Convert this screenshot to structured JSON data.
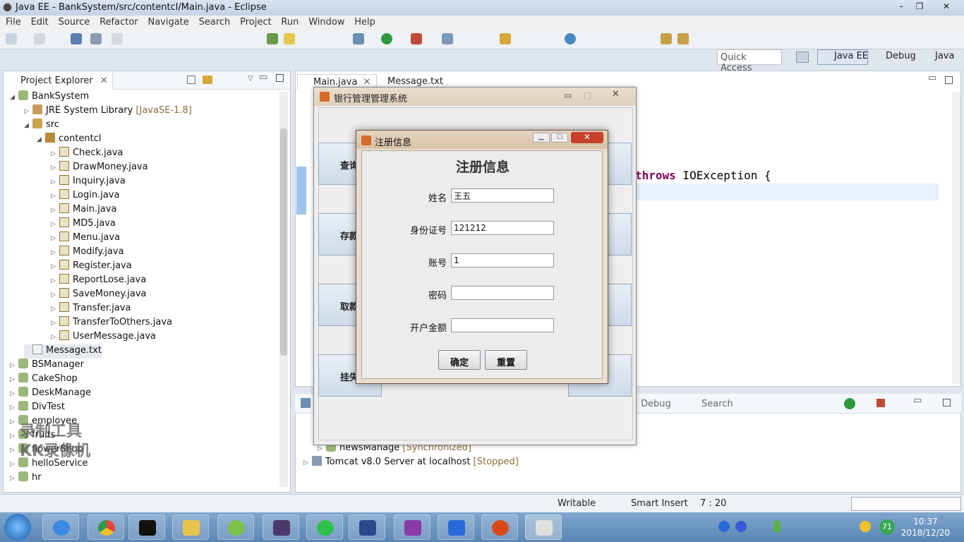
{
  "window": {
    "title": "Java EE - BankSystem/src/contentcl/Main.java - Eclipse"
  },
  "menu": [
    "File",
    "Edit",
    "Source",
    "Refactor",
    "Navigate",
    "Search",
    "Project",
    "Run",
    "Window",
    "Help"
  ],
  "quick_access": "Quick Access",
  "perspectives": [
    "Java EE",
    "Debug",
    "Java"
  ],
  "project_explorer": {
    "title": "Project Explorer",
    "rows": [
      {
        "label": "BankSystem"
      },
      {
        "label": "JRE System Library",
        "suffix": "[JavaSE-1.8]"
      },
      {
        "label": "src"
      },
      {
        "label": "contentcl"
      },
      {
        "label": "Check.java"
      },
      {
        "label": "DrawMoney.java"
      },
      {
        "label": "Inquiry.java"
      },
      {
        "label": "Login.java"
      },
      {
        "label": "Main.java"
      },
      {
        "label": "MD5.java"
      },
      {
        "label": "Menu.java"
      },
      {
        "label": "Modify.java"
      },
      {
        "label": "Register.java"
      },
      {
        "label": "ReportLose.java"
      },
      {
        "label": "SaveMoney.java"
      },
      {
        "label": "Transfer.java"
      },
      {
        "label": "TransferToOthers.java"
      },
      {
        "label": "UserMessage.java"
      },
      {
        "label": "Message.txt"
      },
      {
        "label": "BSManager"
      },
      {
        "label": "CakeShop"
      },
      {
        "label": "DeskManage"
      },
      {
        "label": "DivTest"
      },
      {
        "label": "employee"
      },
      {
        "label": "fruits"
      },
      {
        "label": "flowerShop"
      },
      {
        "label": "helloService"
      },
      {
        "label": "hr"
      }
    ]
  },
  "editor": {
    "tabs": [
      "Main.java",
      "Message.txt"
    ],
    "code_keyword": "throws",
    "code_rest": " IOException {"
  },
  "bottom_panel": {
    "tabs": [
      "Debug",
      "Search"
    ],
    "servers": [
      {
        "name": "newsManage",
        "state": "[Synchronized]"
      },
      {
        "name": "Tomcat v8.0 Server at localhost",
        "state": "[Stopped]"
      }
    ]
  },
  "status": {
    "writable": "Writable",
    "insert": "Smart Insert",
    "position": "7 : 20"
  },
  "bank_window": {
    "title": "银行管理管理系统",
    "buttons": [
      "查询",
      "存款",
      "取款",
      "挂失"
    ]
  },
  "register_dialog": {
    "title": "注册信息",
    "heading": "注册信息",
    "fields": [
      {
        "label": "姓名",
        "value": "王五"
      },
      {
        "label": "身份证号",
        "value": "121212"
      },
      {
        "label": "账号",
        "value": "1"
      },
      {
        "label": "密码",
        "value": ""
      },
      {
        "label": "开户金额",
        "value": ""
      }
    ],
    "confirm": "确定",
    "reset": "重置"
  },
  "watermark": [
    "录制工具",
    "KK录像机"
  ],
  "clock": {
    "time": "10:37",
    "date": "2018/12/20"
  },
  "tray_badge": "71"
}
